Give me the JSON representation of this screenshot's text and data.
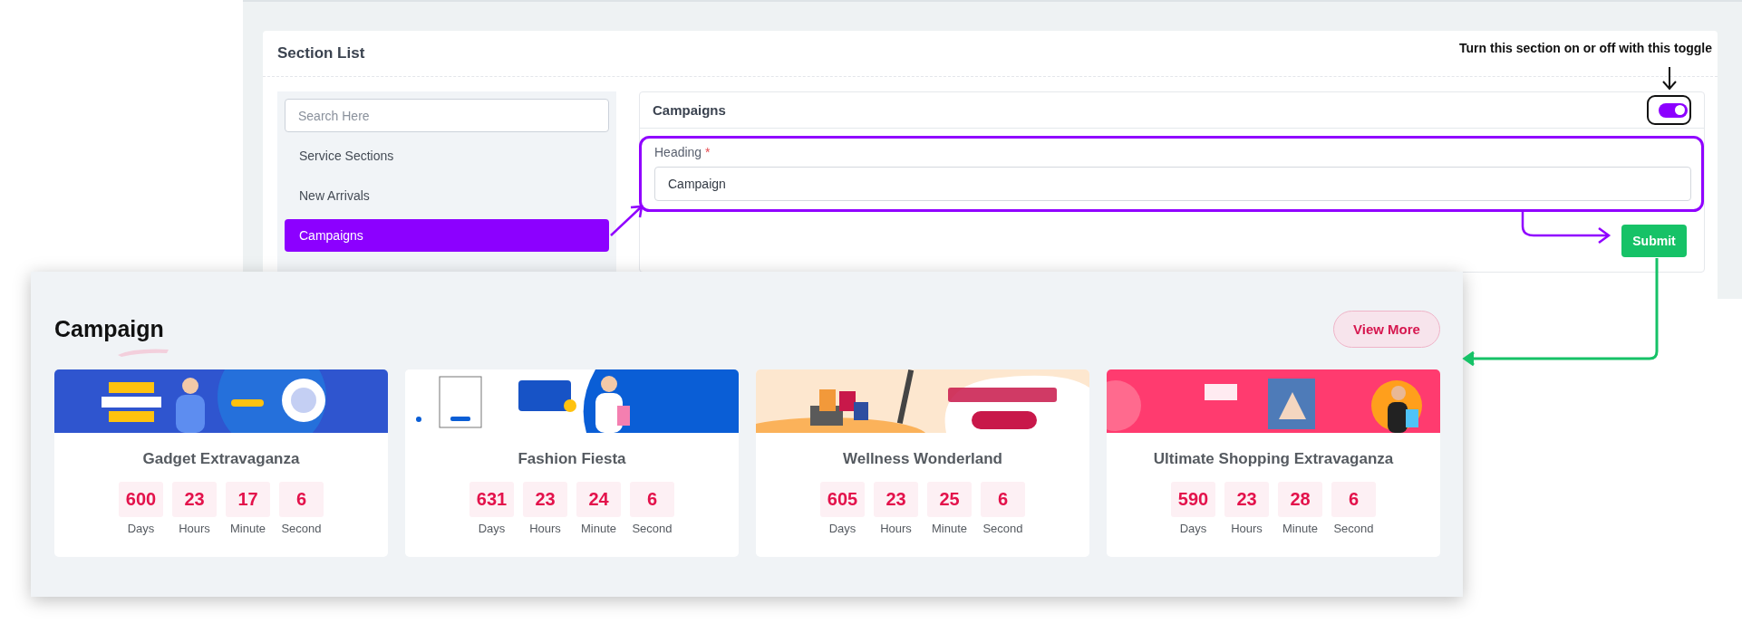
{
  "admin": {
    "title": "Section List",
    "annotation": "Turn this section on or off with this toggle",
    "search": {
      "placeholder": "Search Here"
    },
    "sections": [
      {
        "label": "Service Sections",
        "selected": false
      },
      {
        "label": "New Arrivals",
        "selected": false
      },
      {
        "label": "Campaigns",
        "selected": true
      }
    ],
    "panel": {
      "title": "Campaigns",
      "enabled": true,
      "field": {
        "label": "Heading",
        "required_mark": "*",
        "value": "Campaign"
      },
      "submit": "Submit"
    }
  },
  "preview": {
    "title": "Campaign",
    "view_more": "View More",
    "campaigns": [
      {
        "name": "Gadget Extravaganza",
        "countdown": [
          {
            "value": "600",
            "unit": "Days"
          },
          {
            "value": "23",
            "unit": "Hours"
          },
          {
            "value": "17",
            "unit": "Minute"
          },
          {
            "value": "6",
            "unit": "Second"
          }
        ]
      },
      {
        "name": "Fashion Fiesta",
        "countdown": [
          {
            "value": "631",
            "unit": "Days"
          },
          {
            "value": "23",
            "unit": "Hours"
          },
          {
            "value": "24",
            "unit": "Minute"
          },
          {
            "value": "6",
            "unit": "Second"
          }
        ]
      },
      {
        "name": "Wellness Wonderland",
        "countdown": [
          {
            "value": "605",
            "unit": "Days"
          },
          {
            "value": "23",
            "unit": "Hours"
          },
          {
            "value": "25",
            "unit": "Minute"
          },
          {
            "value": "6",
            "unit": "Second"
          }
        ]
      },
      {
        "name": "Ultimate Shopping Extravaganza",
        "countdown": [
          {
            "value": "590",
            "unit": "Days"
          },
          {
            "value": "23",
            "unit": "Hours"
          },
          {
            "value": "28",
            "unit": "Minute"
          },
          {
            "value": "6",
            "unit": "Second"
          }
        ]
      }
    ]
  }
}
